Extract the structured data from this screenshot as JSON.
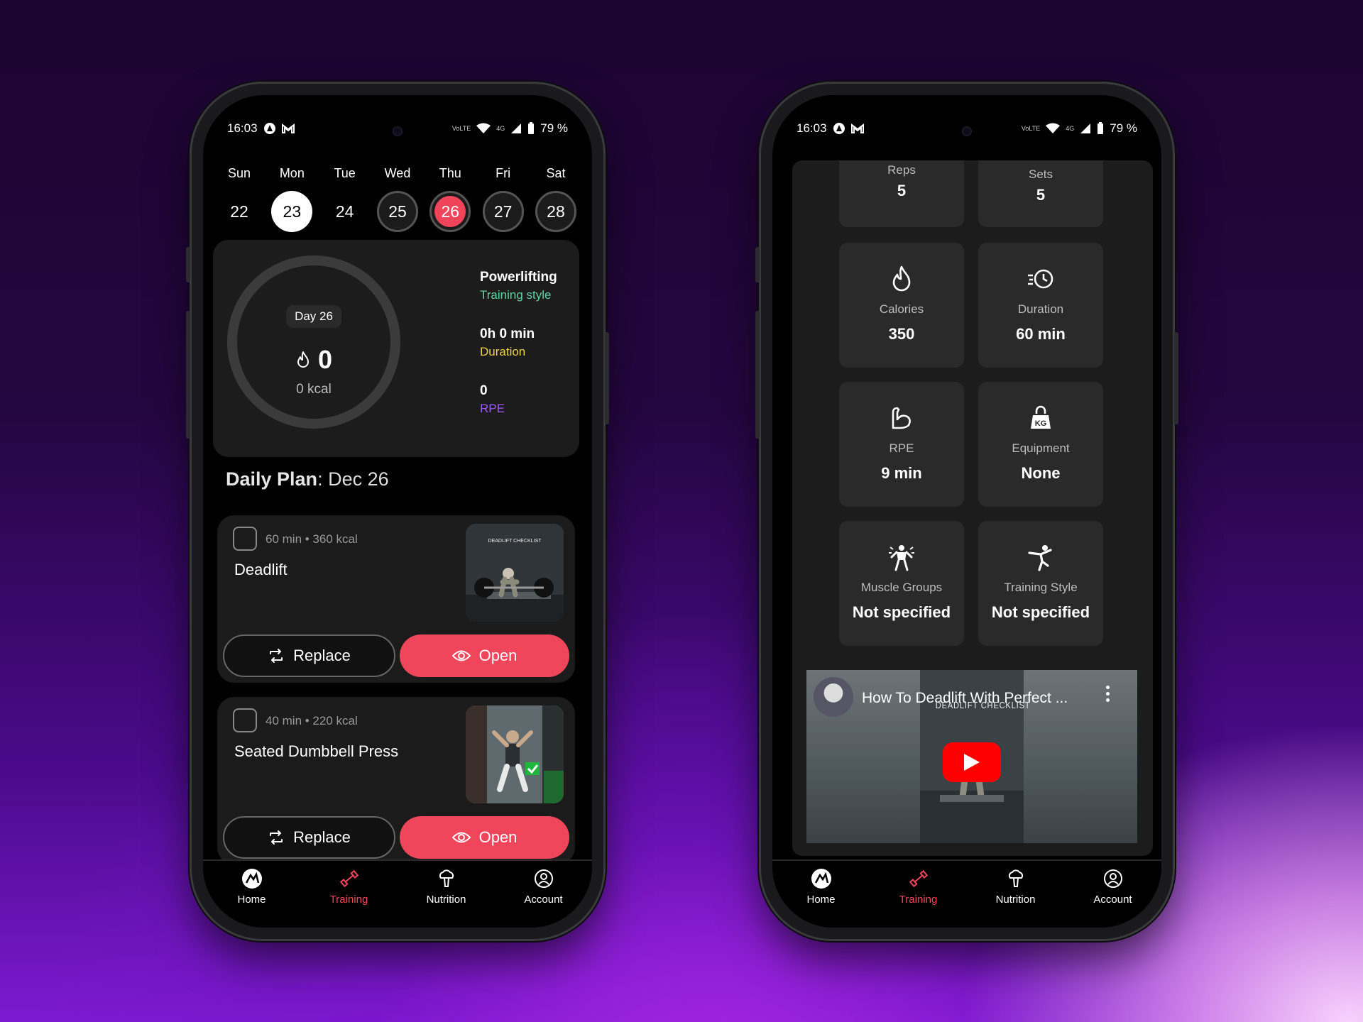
{
  "status": {
    "time": "16:03",
    "battery": "79 %",
    "net": "4G",
    "volte": "VoLTE"
  },
  "calendar": {
    "days": [
      {
        "name": "Sun",
        "num": "22"
      },
      {
        "name": "Mon",
        "num": "23"
      },
      {
        "name": "Tue",
        "num": "24"
      },
      {
        "name": "Wed",
        "num": "25"
      },
      {
        "name": "Thu",
        "num": "26"
      },
      {
        "name": "Fri",
        "num": "27"
      },
      {
        "name": "Sat",
        "num": "28"
      }
    ]
  },
  "summary": {
    "day_label": "Day 26",
    "calories": "0",
    "kcal_text": "0 kcal",
    "style_value": "Powerlifting",
    "style_label": "Training style",
    "duration_value": "0h 0 min",
    "duration_label": "Duration",
    "rpe_value": "0",
    "rpe_label": "RPE",
    "colors": {
      "style": "#5fd3a6",
      "duration": "#f0d04a",
      "rpe": "#9b5cf0"
    }
  },
  "daily_plan": {
    "title": "Daily Plan",
    "date": ": Dec 26"
  },
  "exercises": [
    {
      "meta": "60 min • 360 kcal",
      "name": "Deadlift",
      "replace": "Replace",
      "open": "Open"
    },
    {
      "meta": "40 min • 220 kcal",
      "name": "Seated Dumbbell Press",
      "replace": "Replace",
      "open": "Open"
    }
  ],
  "details": {
    "reps_label": "Reps",
    "reps_value": "5",
    "sets_label": "Sets",
    "sets_value": "5",
    "calories_label": "Calories",
    "calories_value": "350",
    "duration_label": "Duration",
    "duration_value": "60 min",
    "rpe_label": "RPE",
    "rpe_value": "9 min",
    "equipment_label": "Equipment",
    "equipment_value": "None",
    "muscle_label": "Muscle Groups",
    "muscle_value": "Not specified",
    "style_label": "Training Style",
    "style_value": "Not specified"
  },
  "video": {
    "title": "How To Deadlift With Perfect ...",
    "overlay": "DEADLIFT CHECKLIST"
  },
  "nav": {
    "home": "Home",
    "training": "Training",
    "nutrition": "Nutrition",
    "account": "Account"
  },
  "colors": {
    "accent": "#f0465b"
  }
}
